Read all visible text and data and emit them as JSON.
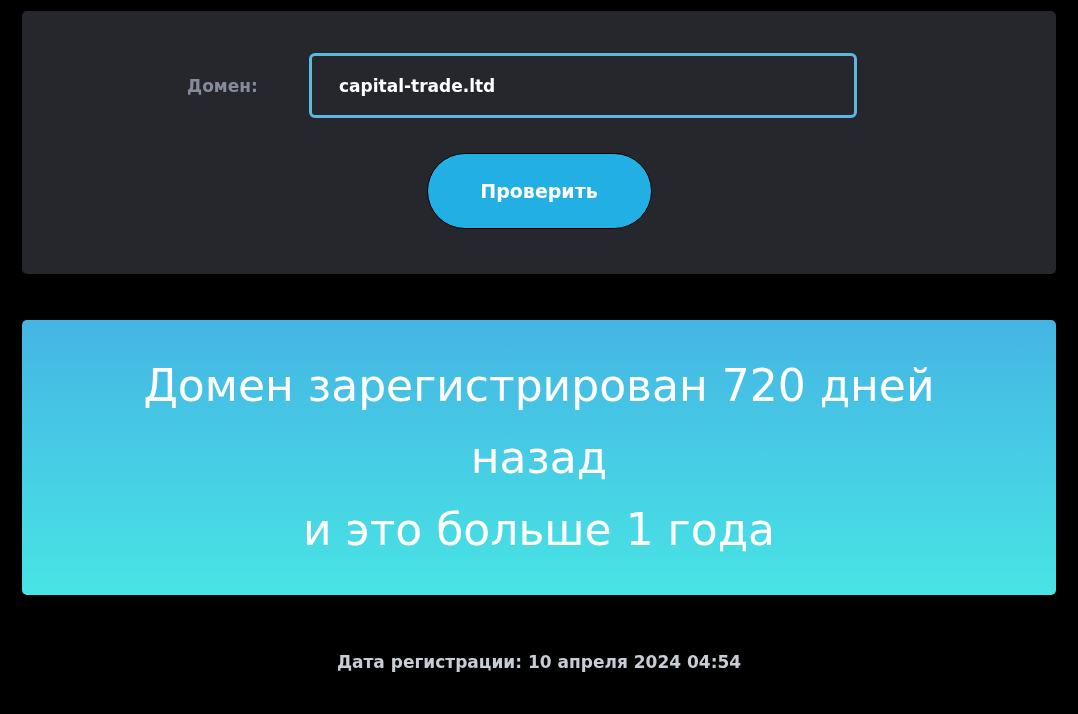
{
  "form": {
    "label": "Домен:",
    "domain_value": "capital-trade.ltd",
    "button": "Проверить"
  },
  "result": {
    "message": "Домен зарегистрирован 720 дней назад\nи это больше 1 года"
  },
  "registration_date": "Дата регистрации: 10 апреля 2024 04:54"
}
